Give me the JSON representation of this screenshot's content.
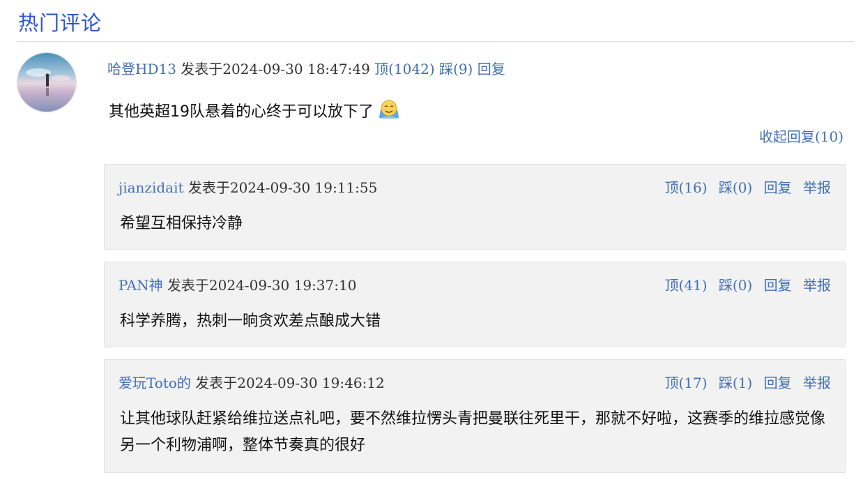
{
  "section": {
    "title": "热门评论"
  },
  "comment": {
    "user": "哈登HD13",
    "posted": "发表于2024-09-30 18:47:49",
    "up": "顶(1042)",
    "down": "踩(9)",
    "reply": "回复",
    "text": "其他英超19队悬着的心终于可以放下了",
    "emoji_icon": "smiley-emoji-icon",
    "collapse": "收起回复(10)"
  },
  "replies": [
    {
      "user": "jianzidait",
      "posted": "发表于2024-09-30 19:11:55",
      "up": "顶(16)",
      "down": "踩(0)",
      "reply": "回复",
      "report": "举报",
      "text": "希望互相保持冷静"
    },
    {
      "user": "PAN神",
      "posted": "发表于2024-09-30 19:37:10",
      "up": "顶(41)",
      "down": "踩(0)",
      "reply": "回复",
      "report": "举报",
      "text": "科学养腾，热刺一晌贪欢差点酿成大错"
    },
    {
      "user": "爱玩Toto的",
      "posted": "发表于2024-09-30 19:46:12",
      "up": "顶(17)",
      "down": "踩(1)",
      "reply": "回复",
      "report": "举报",
      "text": "让其他球队赶紧给维拉送点礼吧，要不然维拉愣头青把曼联往死里干，那就不好啦，这赛季的维拉感觉像另一个利物浦啊，整体节奏真的很好"
    }
  ],
  "colors": {
    "title": "#2b55d6",
    "link": "#4170b6",
    "reply_bg": "#f2f2f2"
  }
}
